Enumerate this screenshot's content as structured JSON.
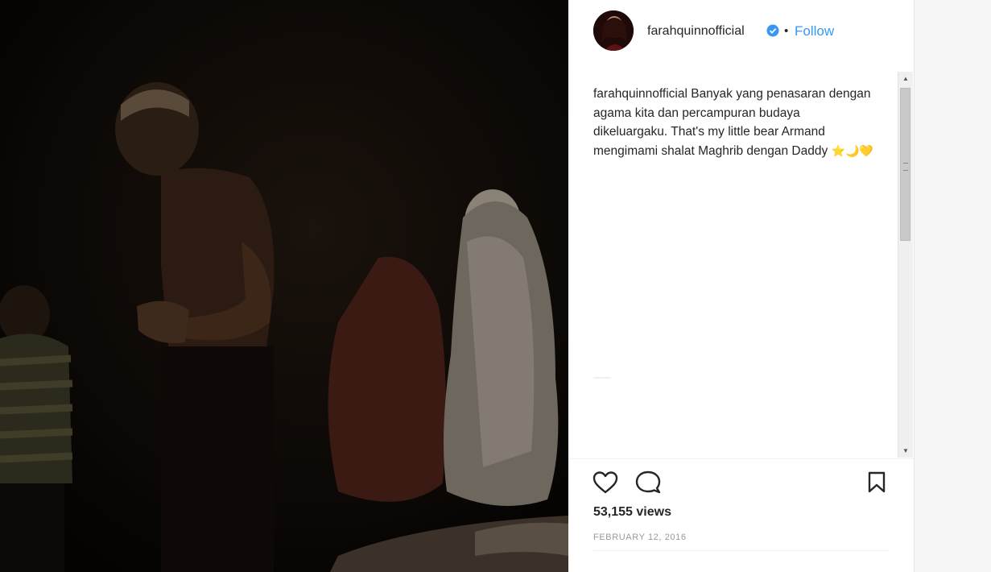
{
  "post": {
    "username": "farahquinnofficial",
    "follow_label": "Follow",
    "separator": "•",
    "caption_user": "farahquinnofficial",
    "caption_text": " Banyak yang penasaran dengan agama kita dan percampuran budaya dikeluargaku. That's my little bear Armand mengimami shalat Maghrib dengan Daddy ",
    "caption_emoji": "⭐🌙💛",
    "views": "53,155 views",
    "date": "FEBRUARY 12, 2016"
  },
  "icons": {
    "like": "heart-icon",
    "comment": "comment-bubble-icon",
    "save": "bookmark-icon",
    "verified": "verified-badge-icon"
  },
  "colors": {
    "link": "#3897f0",
    "verified": "#3897f0",
    "text": "#262626",
    "muted": "#999999"
  }
}
